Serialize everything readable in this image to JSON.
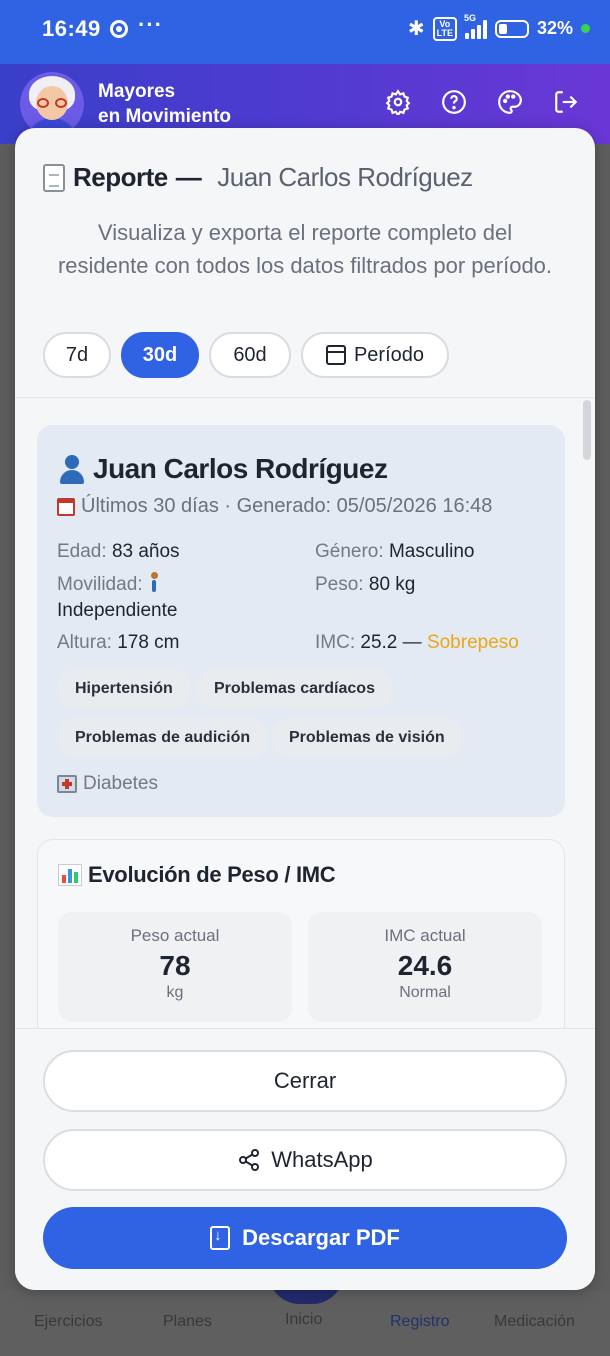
{
  "status_bar": {
    "time": "16:49",
    "more": "···",
    "network": "5G",
    "lte": "Vo LTE",
    "battery": "32%"
  },
  "header": {
    "app_title_line1": "Mayores",
    "app_title_line2": "en Movimiento",
    "icons": [
      "settings-icon",
      "help-icon",
      "palette-icon",
      "logout-icon"
    ]
  },
  "report": {
    "title_prefix": "Reporte",
    "title_dash": "—",
    "resident_name": "Juan Carlos Rodríguez",
    "subtitle": "Visualiza y exporta el reporte completo del residente con todos los datos filtrados por período.",
    "periods": [
      {
        "label": "7d",
        "active": false
      },
      {
        "label": "30d",
        "active": true
      },
      {
        "label": "60d",
        "active": false
      },
      {
        "label": "Período",
        "active": false
      }
    ]
  },
  "resident": {
    "name": "Juan Carlos Rodríguez",
    "period_text": "Últimos 30 días · Generado: 05/05/2026 16:48",
    "age_label": "Edad:",
    "age_value": "83 años",
    "gender_label": "Género:",
    "gender_value": "Masculino",
    "mobility_label": "Movilidad:",
    "mobility_value": "Independiente",
    "weight_label": "Peso:",
    "weight_value": "80 kg",
    "height_label": "Altura:",
    "height_value": "178 cm",
    "bmi_label": "IMC:",
    "bmi_value": "25.2 —",
    "bmi_status": "Sobrepeso",
    "conditions": [
      "Hipertensión",
      "Problemas cardíacos",
      "Problemas de audición",
      "Problemas de visión"
    ],
    "extra_condition": "Diabetes"
  },
  "weight_section": {
    "title": "Evolución de Peso / IMC",
    "current_weight_label": "Peso actual",
    "current_weight_value": "78",
    "current_weight_unit": "kg",
    "current_bmi_label": "IMC actual",
    "current_bmi_value": "24.6",
    "current_bmi_status": "Normal"
  },
  "actions": {
    "close": "Cerrar",
    "whatsapp": "WhatsApp",
    "download": "Descargar PDF"
  },
  "bottom_nav": [
    "Ejercicios",
    "Planes",
    "Inicio",
    "Registro",
    "Medicación"
  ],
  "colors": {
    "primary": "#2f63e3",
    "header_gradient_start": "#3a3fc9",
    "header_gradient_end": "#6a37d6",
    "warning": "#e9a81a",
    "card_bg": "#e4eaf3"
  }
}
